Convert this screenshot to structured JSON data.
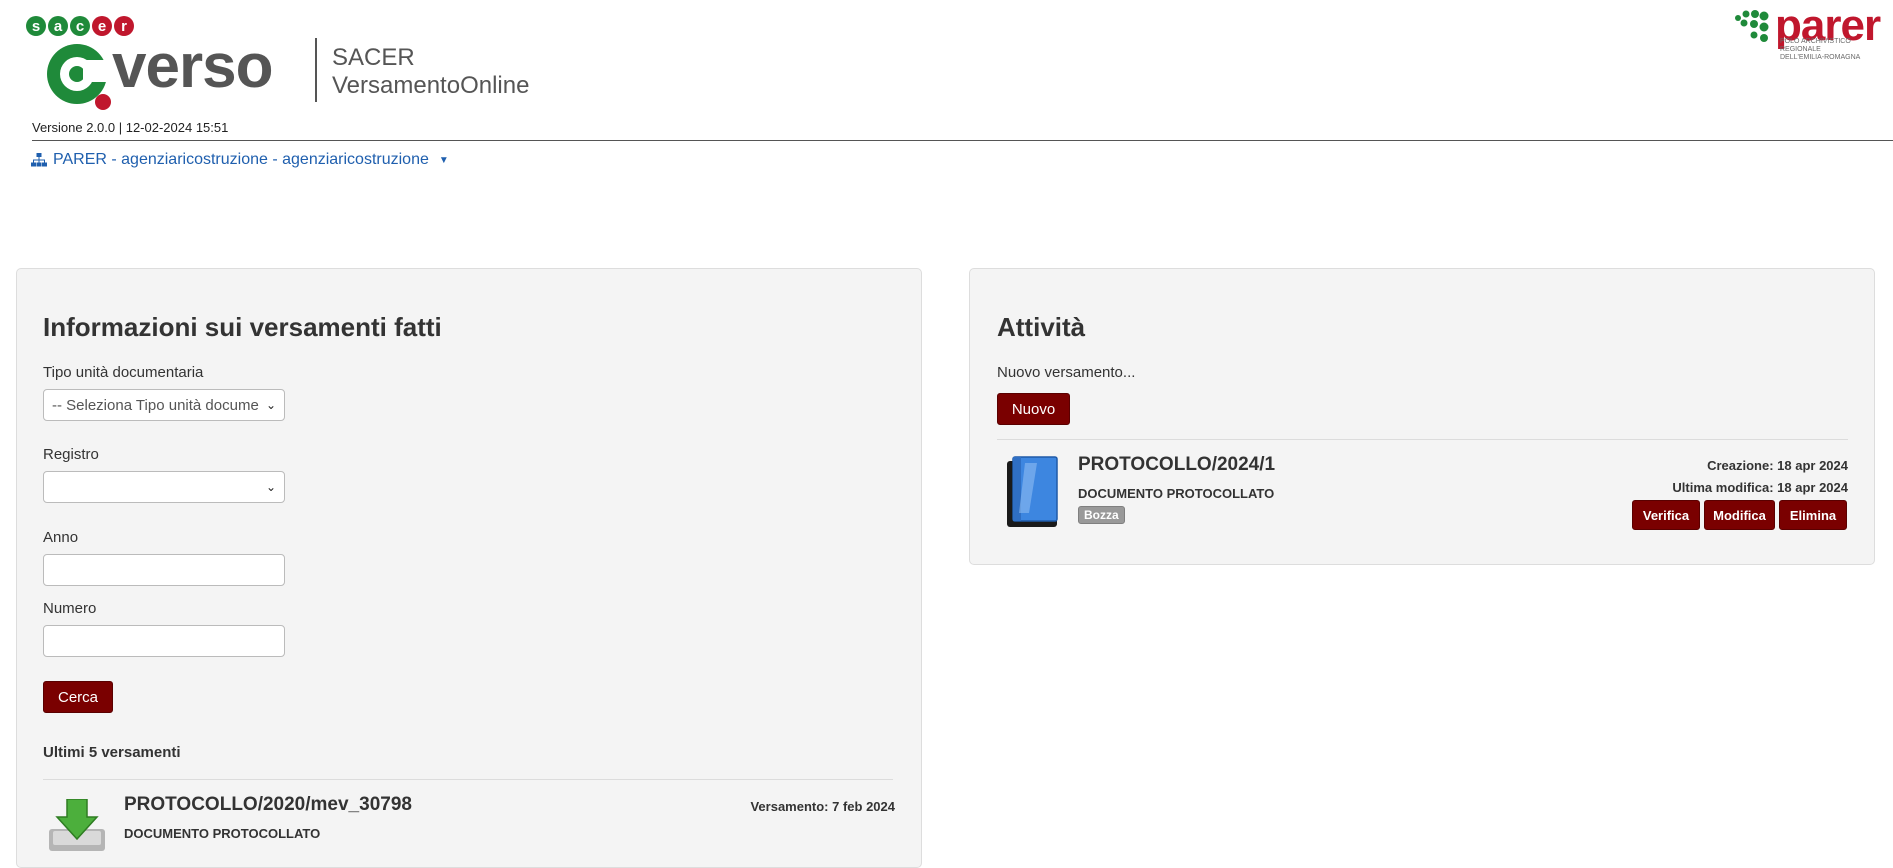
{
  "header": {
    "brand_small": "sacer",
    "brand_main": "verso",
    "app_title_line1": "SACER",
    "app_title_line2": "VersamentoOnline",
    "version": "Versione 2.0.0 | 12-02-2024 15:51",
    "ente_selector": "PARER - agenziaricostruzione - agenziaricostruzione",
    "partner_logo": {
      "name": "parer",
      "subtitle_line1": "POLO ARCHIVISTICO REGIONALE",
      "subtitle_line2": "DELL'EMILIA-ROMAGNA"
    }
  },
  "left_panel": {
    "title": "Informazioni sui versamenti fatti",
    "fields": {
      "tipo_label": "Tipo unità documentaria",
      "tipo_value": "-- Seleziona Tipo unità docume",
      "registro_label": "Registro",
      "registro_value": "",
      "anno_label": "Anno",
      "anno_value": "",
      "numero_label": "Numero",
      "numero_value": ""
    },
    "search_button": "Cerca",
    "recent_title": "Ultimi 5 versamenti",
    "recent_items": [
      {
        "title": "PROTOCOLLO/2020/mev_30798",
        "subtitle": "DOCUMENTO PROTOCOLLATO",
        "meta": "Versamento: 7 feb 2024",
        "icon": "download-arrow-icon"
      }
    ]
  },
  "right_panel": {
    "title": "Attività",
    "new_label": "Nuovo versamento...",
    "new_button": "Nuovo",
    "activities": [
      {
        "title": "PROTOCOLLO/2024/1",
        "subtitle": "DOCUMENTO PROTOCOLLATO",
        "status": "Bozza",
        "created": "Creazione: 18 apr 2024",
        "modified": "Ultima modifica: 18 apr 2024",
        "icon": "book-icon",
        "actions": [
          "Verifica",
          "Modifica",
          "Elimina"
        ]
      }
    ]
  },
  "colors": {
    "button_red": "#7a0000",
    "link_blue": "#1f5fae",
    "panel_bg": "#f4f4f4",
    "brand_green": "#1f8a3a",
    "brand_red": "#c0172d"
  }
}
